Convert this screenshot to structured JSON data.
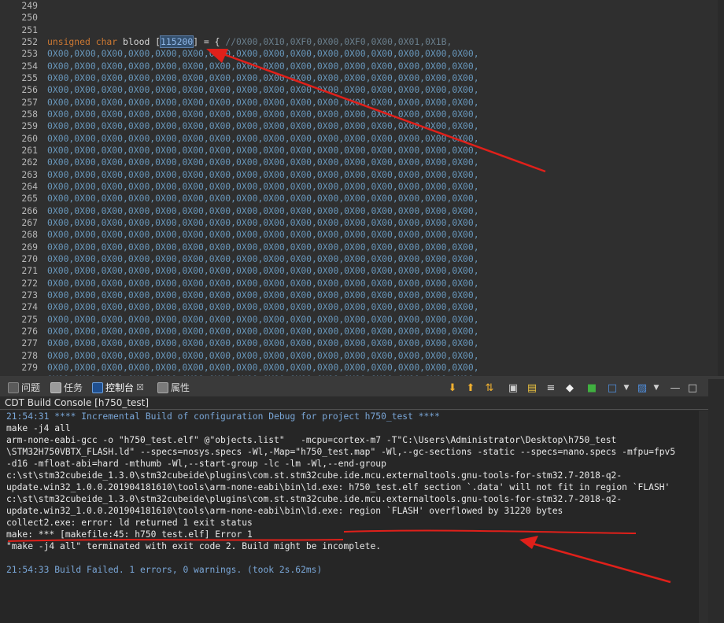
{
  "editor": {
    "lines": [
      {
        "num": "249",
        "code": ""
      },
      {
        "num": "250",
        "code": ""
      },
      {
        "num": "251",
        "code": ""
      },
      {
        "num": "252",
        "code": "",
        "decl": {
          "keyword": "unsigned char",
          "ident": "blood",
          "open": "[",
          "size": "115200",
          "close": "] = {",
          "comment": "//0X00,0X10,0XF0,0X00,0XF0,0X00,0X01,0X1B,"
        }
      },
      {
        "num": "253",
        "code": "0X00,0X00,0X00,0X00,0X00,0X00,0X00,0X00,0X00,0X00,0X00,0X00,0X00,0X00,0X00,0X00,"
      },
      {
        "num": "254",
        "code": "0X00,0X00,0X00,0X00,0X00,0X00,0X00,0X00,0X00,0X00,0X00,0X00,0X00,0X00,0X00,0X00,"
      },
      {
        "num": "255",
        "code": "0X00,0X00,0X00,0X00,0X00,0X00,0X00,0X00,0X00,0X00,0X00,0X00,0X00,0X00,0X00,0X00,"
      },
      {
        "num": "256",
        "code": "0X00,0X00,0X00,0X00,0X00,0X00,0X00,0X00,0X00,0X00,0X00,0X00,0X00,0X00,0X00,0X00,"
      },
      {
        "num": "257",
        "code": "0X00,0X00,0X00,0X00,0X00,0X00,0X00,0X00,0X00,0X00,0X00,0X00,0X00,0X00,0X00,0X00,"
      },
      {
        "num": "258",
        "code": "0X00,0X00,0X00,0X00,0X00,0X00,0X00,0X00,0X00,0X00,0X00,0X00,0X00,0X00,0X00,0X00,"
      },
      {
        "num": "259",
        "code": "0X00,0X00,0X00,0X00,0X00,0X00,0X00,0X00,0X00,0X00,0X00,0X00,0X00,0X00,0X00,0X00,"
      },
      {
        "num": "260",
        "code": "0X00,0X00,0X00,0X00,0X00,0X00,0X00,0X00,0X00,0X00,0X00,0X00,0X00,0X00,0X00,0X00,"
      },
      {
        "num": "261",
        "code": "0X00,0X00,0X00,0X00,0X00,0X00,0X00,0X00,0X00,0X00,0X00,0X00,0X00,0X00,0X00,0X00,"
      },
      {
        "num": "262",
        "code": "0X00,0X00,0X00,0X00,0X00,0X00,0X00,0X00,0X00,0X00,0X00,0X00,0X00,0X00,0X00,0X00,"
      },
      {
        "num": "263",
        "code": "0X00,0X00,0X00,0X00,0X00,0X00,0X00,0X00,0X00,0X00,0X00,0X00,0X00,0X00,0X00,0X00,"
      },
      {
        "num": "264",
        "code": "0X00,0X00,0X00,0X00,0X00,0X00,0X00,0X00,0X00,0X00,0X00,0X00,0X00,0X00,0X00,0X00,"
      },
      {
        "num": "265",
        "code": "0X00,0X00,0X00,0X00,0X00,0X00,0X00,0X00,0X00,0X00,0X00,0X00,0X00,0X00,0X00,0X00,"
      },
      {
        "num": "266",
        "code": "0X00,0X00,0X00,0X00,0X00,0X00,0X00,0X00,0X00,0X00,0X00,0X00,0X00,0X00,0X00,0X00,"
      },
      {
        "num": "267",
        "code": "0X00,0X00,0X00,0X00,0X00,0X00,0X00,0X00,0X00,0X00,0X00,0X00,0X00,0X00,0X00,0X00,"
      },
      {
        "num": "268",
        "code": "0X00,0X00,0X00,0X00,0X00,0X00,0X00,0X00,0X00,0X00,0X00,0X00,0X00,0X00,0X00,0X00,"
      },
      {
        "num": "269",
        "code": "0X00,0X00,0X00,0X00,0X00,0X00,0X00,0X00,0X00,0X00,0X00,0X00,0X00,0X00,0X00,0X00,"
      },
      {
        "num": "270",
        "code": "0X00,0X00,0X00,0X00,0X00,0X00,0X00,0X00,0X00,0X00,0X00,0X00,0X00,0X00,0X00,0X00,"
      },
      {
        "num": "271",
        "code": "0X00,0X00,0X00,0X00,0X00,0X00,0X00,0X00,0X00,0X00,0X00,0X00,0X00,0X00,0X00,0X00,"
      },
      {
        "num": "272",
        "code": "0X00,0X00,0X00,0X00,0X00,0X00,0X00,0X00,0X00,0X00,0X00,0X00,0X00,0X00,0X00,0X00,"
      },
      {
        "num": "273",
        "code": "0X00,0X00,0X00,0X00,0X00,0X00,0X00,0X00,0X00,0X00,0X00,0X00,0X00,0X00,0X00,0X00,"
      },
      {
        "num": "274",
        "code": "0X00,0X00,0X00,0X00,0X00,0X00,0X00,0X00,0X00,0X00,0X00,0X00,0X00,0X00,0X00,0X00,"
      },
      {
        "num": "275",
        "code": "0X00,0X00,0X00,0X00,0X00,0X00,0X00,0X00,0X00,0X00,0X00,0X00,0X00,0X00,0X00,0X00,"
      },
      {
        "num": "276",
        "code": "0X00,0X00,0X00,0X00,0X00,0X00,0X00,0X00,0X00,0X00,0X00,0X00,0X00,0X00,0X00,0X00,"
      },
      {
        "num": "277",
        "code": "0X00,0X00,0X00,0X00,0X00,0X00,0X00,0X00,0X00,0X00,0X00,0X00,0X00,0X00,0X00,0X00,"
      },
      {
        "num": "278",
        "code": "0X00,0X00,0X00,0X00,0X00,0X00,0X00,0X00,0X00,0X00,0X00,0X00,0X00,0X00,0X00,0X00,"
      },
      {
        "num": "279",
        "code": "0X00,0X00,0X00,0X00,0X00,0X00,0X00,0X00,0X00,0X00,0X00,0X00,0X00,0X00,0X00,0X00,"
      },
      {
        "num": "",
        "code": "0X00,0X00,0X00,0X00,0X00,0X00,0X00,0X00,0X00,0X00,0X00,0X00,0X00,0X00,0X00,0X00,"
      }
    ]
  },
  "panel": {
    "tabs": [
      {
        "label": "问题",
        "icon": "problems-icon"
      },
      {
        "label": "任务",
        "icon": "tasks-icon"
      },
      {
        "label": "控制台",
        "icon": "console-icon",
        "close": "☒"
      },
      {
        "label": "属性",
        "icon": "properties-icon"
      }
    ],
    "console_title": "CDT Build Console [h750_test]",
    "toolbar_icons": [
      "arrow-down-icon",
      "arrow-up-icon",
      "swap-icon",
      "pin-icon",
      "lock-icon",
      "word-wrap-icon",
      "clear-icon",
      "open-console-icon",
      "display-selected-icon",
      "new-console-icon",
      "minimize-icon",
      "maximize-icon"
    ]
  },
  "console": {
    "lines": [
      {
        "text": "21:54:31 **** Incremental Build of configuration Debug for project h750_test ****",
        "kind": "info"
      },
      {
        "text": "make -j4 all",
        "kind": "normal"
      },
      {
        "text": "arm-none-eabi-gcc -o \"h750_test.elf\" @\"objects.list\"   -mcpu=cortex-m7 -T\"C:\\Users\\Administrator\\Desktop\\h750_test",
        "kind": "normal"
      },
      {
        "text": "\\STM32H750VBTX_FLASH.ld\" --specs=nosys.specs -Wl,-Map=\"h750_test.map\" -Wl,--gc-sections -static --specs=nano.specs -mfpu=fpv5",
        "kind": "normal"
      },
      {
        "text": "-d16 -mfloat-abi=hard -mthumb -Wl,--start-group -lc -lm -Wl,--end-group",
        "kind": "normal"
      },
      {
        "text": "c:\\st\\stm32cubeide_1.3.0\\stm32cubeide\\plugins\\com.st.stm32cube.ide.mcu.externaltools.gnu-tools-for-stm32.7-2018-q2-",
        "kind": "normal"
      },
      {
        "text": "update.win32_1.0.0.201904181610\\tools\\arm-none-eabi\\bin\\ld.exe: h750_test.elf section `.data' will not fit in region `FLASH'",
        "kind": "normal"
      },
      {
        "text": "c:\\st\\stm32cubeide_1.3.0\\stm32cubeide\\plugins\\com.st.stm32cube.ide.mcu.externaltools.gnu-tools-for-stm32.7-2018-q2-",
        "kind": "normal"
      },
      {
        "text": "update.win32_1.0.0.201904181610\\tools\\arm-none-eabi\\bin\\ld.exe: region `FLASH' overflowed by 31220 bytes",
        "kind": "normal"
      },
      {
        "text": "collect2.exe: error: ld returned 1 exit status",
        "kind": "normal"
      },
      {
        "text": "make: *** [makefile:45: h750_test.elf] Error 1",
        "kind": "normal"
      },
      {
        "text": "\"make -j4 all\" terminated with exit code 2. Build might be incomplete.",
        "kind": "normal"
      },
      {
        "text": "",
        "kind": "normal"
      },
      {
        "text": "21:54:33 Build Failed. 1 errors, 0 warnings. (took 2s.62ms)",
        "kind": "info"
      }
    ]
  },
  "colors": {
    "annotation": "#e0201a",
    "keyword": "#cc7832",
    "number": "#6897bb",
    "info": "#7aa7d8"
  }
}
